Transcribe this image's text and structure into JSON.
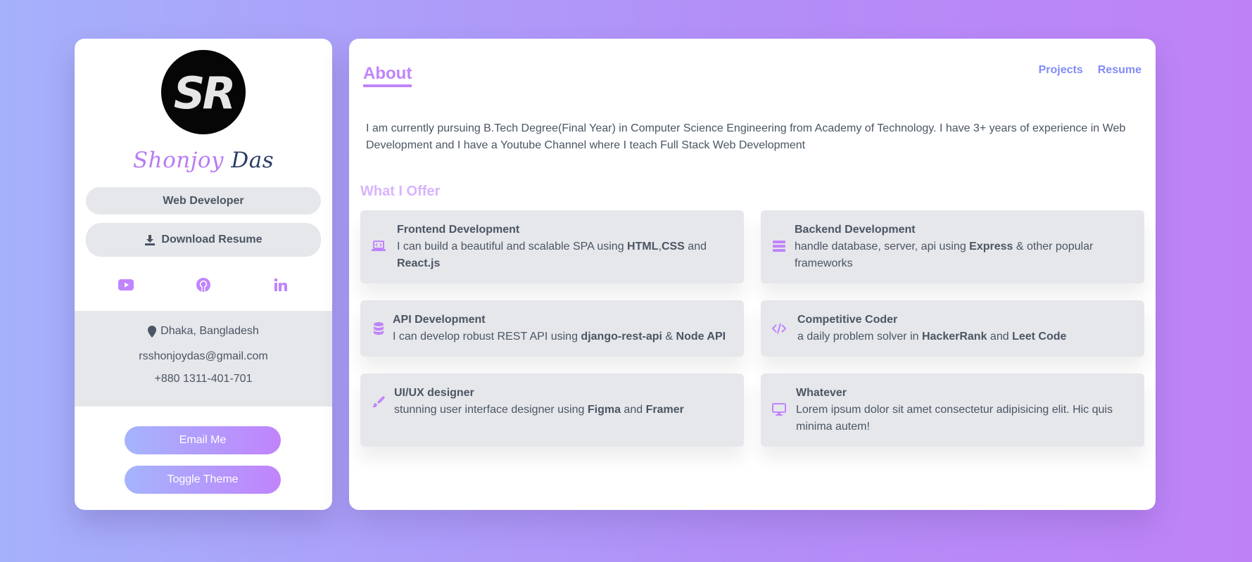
{
  "profile": {
    "logo_text": "SR",
    "first_name": "Shonjoy",
    "last_name": "Das",
    "role": "Web Developer",
    "download_label": "Download Resume",
    "socials": [
      {
        "name": "youtube-icon"
      },
      {
        "name": "github-icon"
      },
      {
        "name": "linkedin-icon"
      }
    ],
    "location": "Dhaka, Bangladesh",
    "email": "rsshonjoydas@gmail.com",
    "phone": "+880 1311-401-701",
    "email_button": "Email Me",
    "theme_button": "Toggle Theme"
  },
  "nav": {
    "active": "About",
    "links": [
      "Projects",
      "Resume"
    ]
  },
  "about": {
    "intro": "I am currently pursuing B.Tech Degree(Final Year) in Computer Science Engineering from Academy of Technology. I have 3+ years of experience in Web Development and I have a Youtube Channel where I teach Full Stack Web Development",
    "offer_title": "What I Offer",
    "offers": [
      {
        "title": "Frontend Development",
        "icon": "laptop-code-icon",
        "parts": [
          "I can build a beautiful and scalable SPA using ",
          "HTML",
          ",",
          "CSS",
          " and ",
          "React.js"
        ]
      },
      {
        "title": "Backend Development",
        "icon": "server-icon",
        "parts": [
          "handle database, server, api using ",
          "Express",
          " & other popular frameworks"
        ]
      },
      {
        "title": "API Development",
        "icon": "database-icon",
        "parts": [
          "I can develop robust REST API using ",
          "django-rest-api",
          " & ",
          "Node API"
        ]
      },
      {
        "title": "Competitive Coder",
        "icon": "code-icon",
        "parts": [
          "a daily problem solver in ",
          "HackerRank",
          " and ",
          "Leet Code"
        ]
      },
      {
        "title": "UI/UX designer",
        "icon": "paint-brush-icon",
        "parts": [
          "stunning user interface designer using ",
          "Figma",
          " and ",
          "Framer"
        ]
      },
      {
        "title": "Whatever",
        "icon": "desktop-icon",
        "parts": [
          "Lorem ipsum dolor sit amet consectetur adipisicing elit. Hic quis minima autem!"
        ]
      }
    ]
  },
  "colors": {
    "accent": "#c084fc",
    "nav_link": "#818cf8",
    "card_bg": "#e5e7eb",
    "text": "#4b5563",
    "name_first": "#b87cf2",
    "name_last": "#2c3e66",
    "logo_gold": "#e0a030"
  }
}
